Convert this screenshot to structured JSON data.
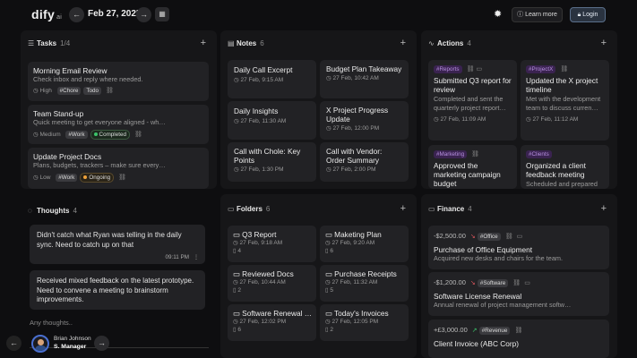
{
  "brand": {
    "logo": "dify",
    "logo_suffix": "ai"
  },
  "header": {
    "date": "Feb 27, 2025",
    "learn_more": "Learn more",
    "login": "Login"
  },
  "tasks": {
    "title": "Tasks",
    "count": "1/4",
    "items": [
      {
        "title": "Morning Email Review",
        "desc": "Check inbox and reply where needed.",
        "priority": "High",
        "tags": [
          "#Chore",
          "Todo"
        ]
      },
      {
        "title": "Team Stand-up",
        "desc": "Quick meeting to get everyone aligned - wh…",
        "priority": "Medium",
        "tags": [
          "#Work"
        ],
        "status": "Completed"
      },
      {
        "title": "Update Project Docs",
        "desc": "Plans, budgets, trackers – make sure every…",
        "priority": "Low",
        "tags": [
          "#Work"
        ],
        "status": "Ongoing"
      }
    ]
  },
  "notes": {
    "title": "Notes",
    "count": "6",
    "items": [
      {
        "title": "Daily Call Excerpt",
        "time": "27 Feb, 9:15 AM"
      },
      {
        "title": "Budget Plan Takeaway",
        "time": "27 Feb, 10:42 AM"
      },
      {
        "title": "Daily Insights",
        "time": "27 Feb, 11:30 AM"
      },
      {
        "title": "X Project Progress Update",
        "time": "27 Feb, 12:00 PM"
      },
      {
        "title": "Call with Chole: Key Points",
        "time": "27 Feb, 1:30 PM"
      },
      {
        "title": "Call with Vendor: Order Summary",
        "time": "27 Feb, 2:00 PM"
      }
    ]
  },
  "actions": {
    "title": "Actions",
    "count": "4",
    "items": [
      {
        "tag": "#Reports",
        "title": "Submitted Q3 report for review",
        "desc": "Completed and sent the quarterly project report…",
        "time": "27 Feb, 11:09 AM"
      },
      {
        "tag": "#ProjectX",
        "title": "Updated the X project timeline",
        "desc": "Met with the development team to discuss curren…",
        "time": "27 Feb, 11:12 AM"
      },
      {
        "tag": "#Marketing",
        "title": "Approved the marketing campaign budget",
        "desc": "",
        "time": ""
      },
      {
        "tag": "#Clients",
        "title": "Organized a client feedback meeting",
        "desc": "Scheduled and prepared",
        "time": ""
      }
    ]
  },
  "thoughts": {
    "title": "Thoughts",
    "count": "4",
    "items": [
      {
        "text": "Didn't catch what Ryan was telling in the daily sync. Need to catch up on that",
        "time": "09:11 PM"
      },
      {
        "text": "Received mixed feedback on the latest prototype. Need to convene a meeting to brainstorm improvements.",
        "time": ""
      }
    ],
    "placeholder": "Any thoughts.."
  },
  "folders": {
    "title": "Folders",
    "count": "6",
    "items": [
      {
        "name": "Q3 Report",
        "time": "27 Feb, 9:18 AM",
        "files": "4"
      },
      {
        "name": "Maketing Plan",
        "time": "27 Feb, 9:20 AM",
        "files": "6"
      },
      {
        "name": "Reviewed Docs",
        "time": "27 Feb, 10:44 AM",
        "files": "2"
      },
      {
        "name": "Purchase Receipts",
        "time": "27 Feb, 11:32 AM",
        "files": "5"
      },
      {
        "name": "Software Renewal …",
        "time": "27 Feb, 12:02 PM",
        "files": "6"
      },
      {
        "name": "Today's Invoices",
        "time": "27 Feb, 12:05 PM",
        "files": "2"
      }
    ]
  },
  "finance": {
    "title": "Finance",
    "count": "4",
    "items": [
      {
        "amount": "-$2,500.00",
        "tag": "#Office",
        "title": "Purchase of Office Equipment",
        "desc": "Acquired new desks and chairs for the team."
      },
      {
        "amount": "-$1,200.00",
        "tag": "#Software",
        "title": "Software License Renewal",
        "desc": "Annual renewal of project management softw…"
      },
      {
        "amount": "+£3,000.00",
        "tag": "#Revenue",
        "title": "Client Invoice (ABC Corp)",
        "desc": ""
      }
    ]
  },
  "user": {
    "name": "Brian Johnson",
    "role": "S. Manager"
  },
  "colors": {
    "background": "#0e0e10",
    "panel": "#161618",
    "card": "#222225",
    "accent_green": "#3cc46a",
    "accent_orange": "#f0a23a",
    "tag_purple": "#b790e0",
    "expense_red": "#e0585f"
  }
}
